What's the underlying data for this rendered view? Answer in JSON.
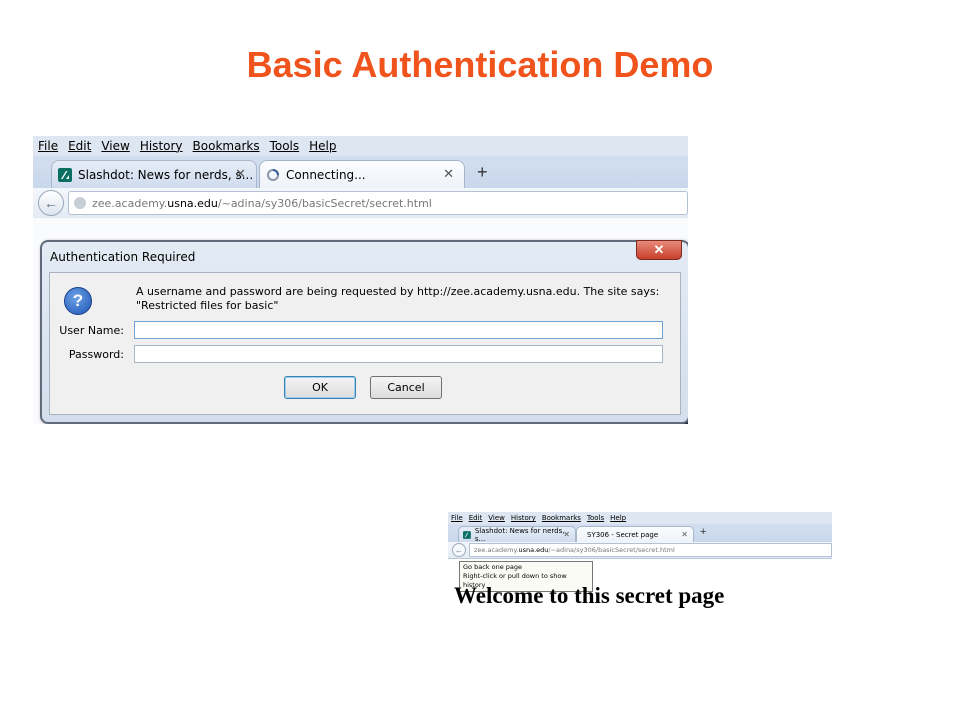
{
  "slide": {
    "title": "Basic Authentication Demo"
  },
  "browser1": {
    "menu": [
      "File",
      "Edit",
      "View",
      "History",
      "Bookmarks",
      "Tools",
      "Help"
    ],
    "tabs": [
      {
        "label": "Slashdot: News for nerds, s...",
        "icon": "slashdot-favicon"
      },
      {
        "label": "Connecting...",
        "icon": "loading-spinner-icon"
      }
    ],
    "url_prefix": "zee.academy.",
    "url_domain": "usna.edu",
    "url_path": "/~adina/sy306/basicSecret/secret.html",
    "dialog": {
      "title": "Authentication Required",
      "message_line1": "A username and password are being requested by http://zee.academy.usna.edu. The site says:",
      "message_line2": "\"Restricted files for basic\"",
      "username_label": "User Name:",
      "password_label": "Password:",
      "username_value": "",
      "password_value": "",
      "ok": "OK",
      "cancel": "Cancel"
    }
  },
  "browser2": {
    "menu": [
      "File",
      "Edit",
      "View",
      "History",
      "Bookmarks",
      "Tools",
      "Help"
    ],
    "tabs": [
      {
        "label": "Slashdot: News for nerds, s..."
      },
      {
        "label": "SY306 - Secret page"
      }
    ],
    "url_prefix": "zee.academy.",
    "url_domain": "usna.edu",
    "url_path": "/~adina/sy306/basicSecret/secret.html",
    "tooltip_line1": "Go back one page",
    "tooltip_line2": "Right-click or pull down to show history",
    "page_heading": "Welcome to this secret page"
  },
  "colors": {
    "title": "#f0531c"
  }
}
